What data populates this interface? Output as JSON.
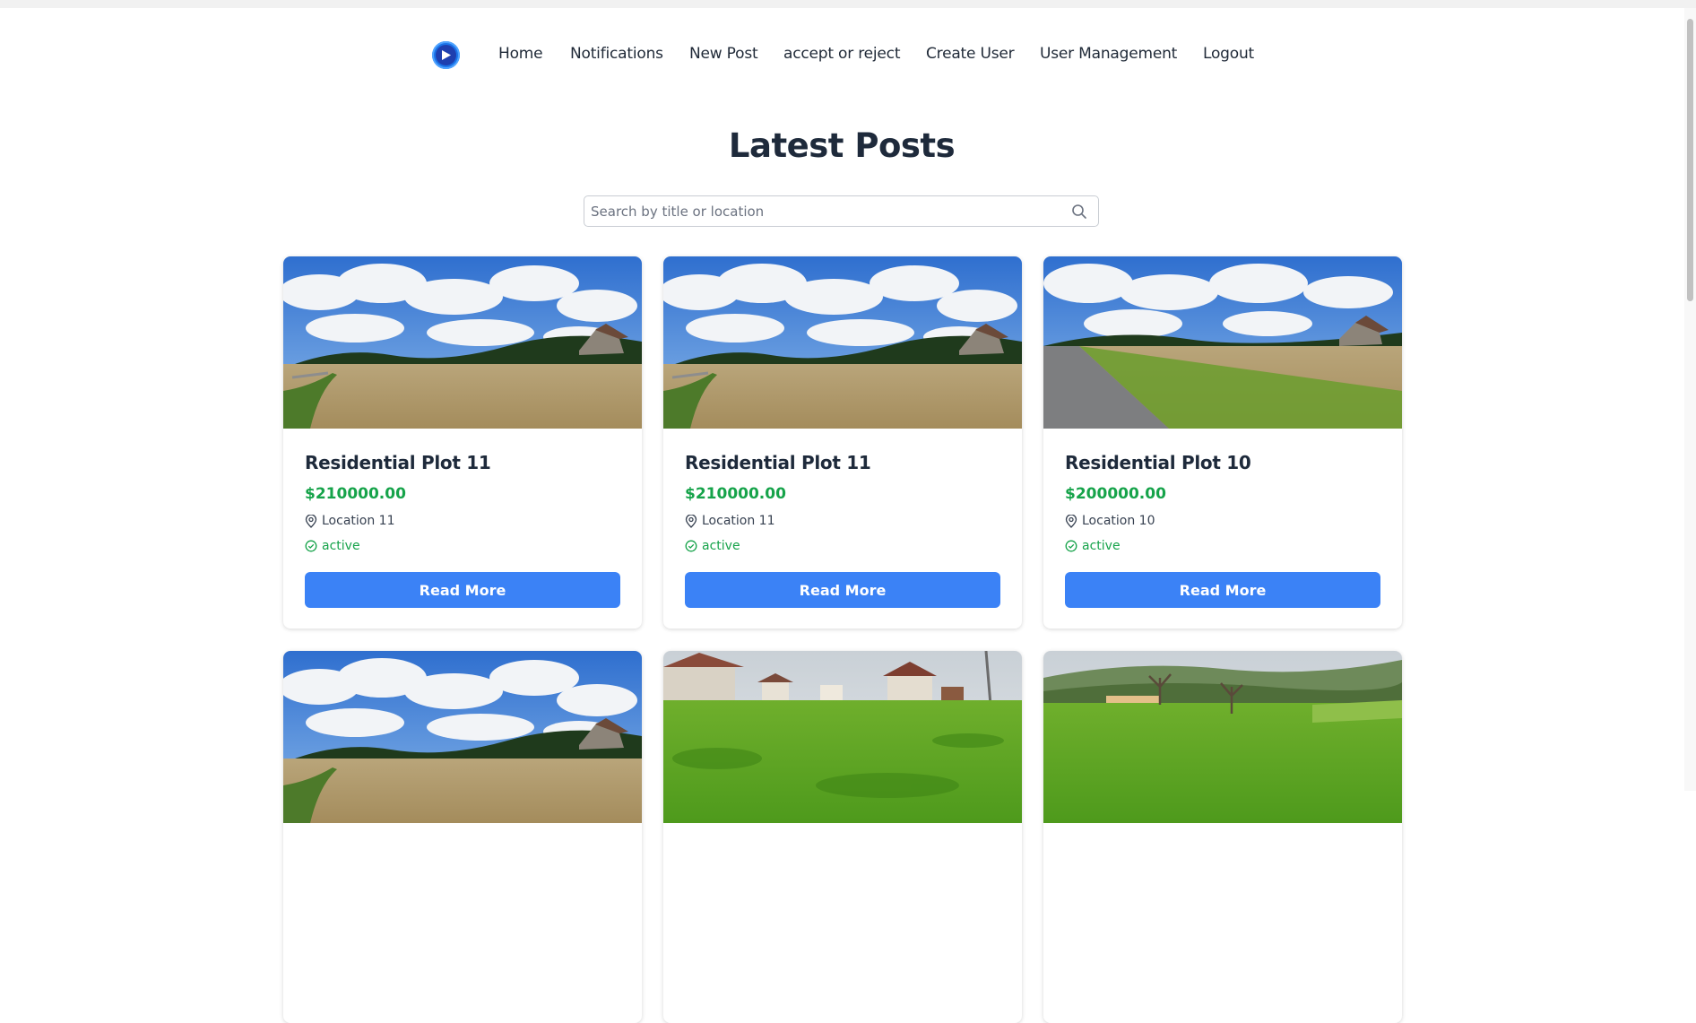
{
  "nav": {
    "logo_icon": "play-circle-logo",
    "links": [
      "Home",
      "Notifications",
      "New Post",
      "accept or reject",
      "Create User",
      "User Management",
      "Logout"
    ]
  },
  "main": {
    "title": "Latest Posts",
    "search": {
      "placeholder": "Search by title or location",
      "value": "",
      "icon": "search-icon"
    }
  },
  "colors": {
    "accent": "#3b82f6",
    "price": "#16a34a",
    "status_active": "#16a34a",
    "heading": "#1e2a3b"
  },
  "posts": [
    {
      "title": "Residential Plot 11",
      "price": "$210000.00",
      "location": "Location 11",
      "status": "active",
      "button": "Read More",
      "image": "wheat-field-with-house"
    },
    {
      "title": "Residential Plot 11",
      "price": "$210000.00",
      "location": "Location 11",
      "status": "active",
      "button": "Read More",
      "image": "wheat-field-with-house"
    },
    {
      "title": "Residential Plot 10",
      "price": "$200000.00",
      "location": "Location 10",
      "status": "active",
      "button": "Read More",
      "image": "field-with-road"
    },
    {
      "image": "wheat-field-with-house"
    },
    {
      "image": "green-lawn-with-houses"
    },
    {
      "image": "green-meadow-hills"
    }
  ]
}
